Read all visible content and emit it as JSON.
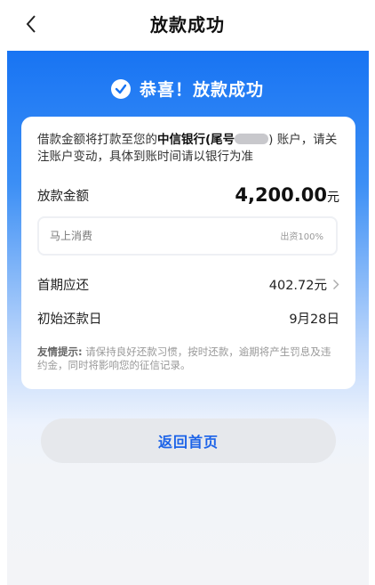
{
  "header": {
    "title": "放款成功"
  },
  "hero": {
    "success_text": "恭喜！放款成功"
  },
  "card": {
    "notice_prefix": "借款金额将打款至您的",
    "bank_name": "中信银行(尾号",
    "notice_suffix": ") 账户，请关注账户变动，具体到账时间请以银行为准",
    "loan_amount_label": "放款金额",
    "loan_amount_value": "4,200.00",
    "loan_amount_unit": "元",
    "lender_name": "马上消费",
    "lender_share": "出资100%",
    "first_repay_label": "首期应还",
    "first_repay_value": "402.72元",
    "initial_date_label": "初始还款日",
    "initial_date_value": "9月28日",
    "tip_label": "友情提示:",
    "tip_text": " 请保持良好还款习惯，按时还款，逾期将产生罚息及违约金，同时将影响您的征信记录。"
  },
  "actions": {
    "home_label": "返回首页"
  },
  "colors": {
    "accent": "#1c63e8",
    "hero_top": "#1874f3"
  }
}
